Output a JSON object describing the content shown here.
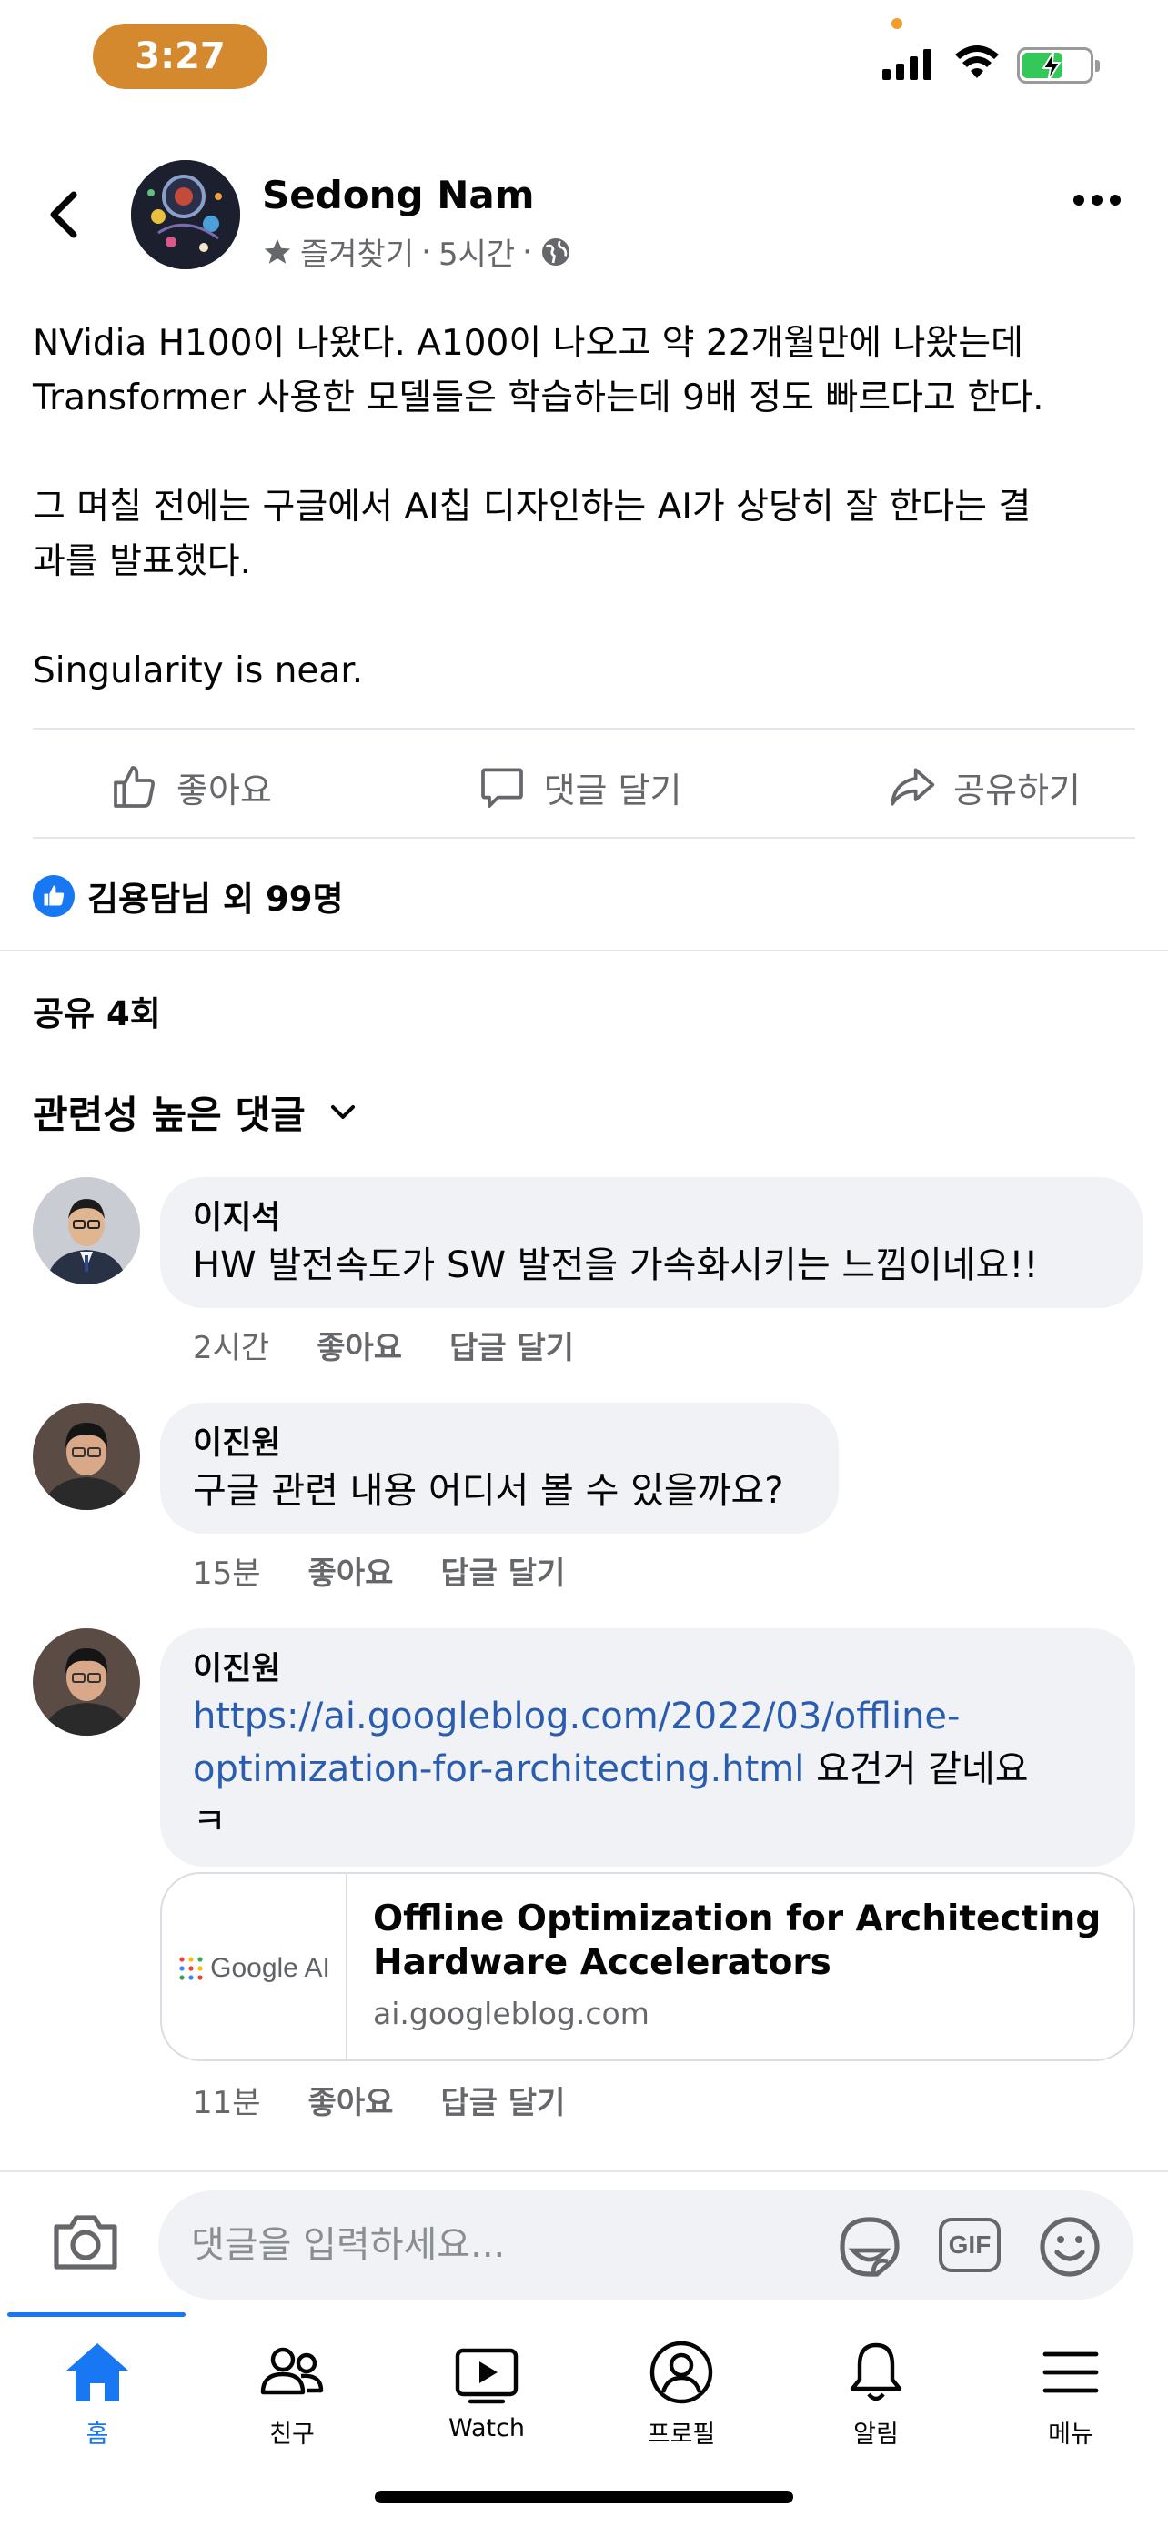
{
  "status_bar": {
    "time": "3:27"
  },
  "post": {
    "author": "Sedong Nam",
    "favorites_label": "즐겨찾기",
    "separator": "·",
    "time_ago": "5시간",
    "paragraphs": [
      "NVidia H100이 나왔다. A100이 나오고 약 22개월만에 나왔는데\nTransformer 사용한 모델들은 학습하는데 9배 정도 빠르다고 한다.",
      "그 며칠 전에는 구글에서 AI칩 디자인하는 AI가 상당히 잘 한다는 결\n과를 발표했다.",
      "Singularity is near."
    ],
    "actions": {
      "like": "좋아요",
      "comment": "댓글 달기",
      "share": "공유하기"
    },
    "reactions_text": "김용담님 외 99명",
    "shares_text": "공유 4회",
    "comment_filter": "관련성 높은 댓글"
  },
  "comments": [
    {
      "name": "이지석",
      "text": "HW 발전속도가 SW 발전을 가속화시키는 느낌이네요!!",
      "time": "2시간",
      "like": "좋아요",
      "reply": "답글 달기"
    },
    {
      "name": "이진원",
      "text": "구글 관련 내용 어디서 볼 수 있을까요?",
      "time": "15분",
      "like": "좋아요",
      "reply": "답글 달기"
    },
    {
      "name": "이진원",
      "link_line1": "https://ai.googleblog.com/2022/03/offline-",
      "link_line2": "optimization-for-architecting.html",
      "text_after": " 요건거 같네요",
      "text_line3": "ㅋ",
      "time": "11분",
      "like": "좋아요",
      "reply": "답글 달기"
    }
  ],
  "link_preview": {
    "thumb_text": "Google AI",
    "title": "Offline Optimization for Architecting Hardware Accelerators",
    "domain": "ai.googleblog.com"
  },
  "composer": {
    "placeholder": "댓글을 입력하세요...",
    "gif_label": "GIF"
  },
  "tabs": [
    {
      "label": "홈",
      "icon": "home-icon",
      "active": true
    },
    {
      "label": "친구",
      "icon": "friends-icon"
    },
    {
      "label": "Watch",
      "icon": "watch-icon"
    },
    {
      "label": "프로필",
      "icon": "profile-icon"
    },
    {
      "label": "알림",
      "icon": "bell-icon"
    },
    {
      "label": "메뉴",
      "icon": "menu-icon"
    }
  ],
  "colors": {
    "accent": "#1877f2",
    "time_pill": "#d4892e",
    "link": "#2a5db0",
    "bubble": "#f0f2f5"
  }
}
